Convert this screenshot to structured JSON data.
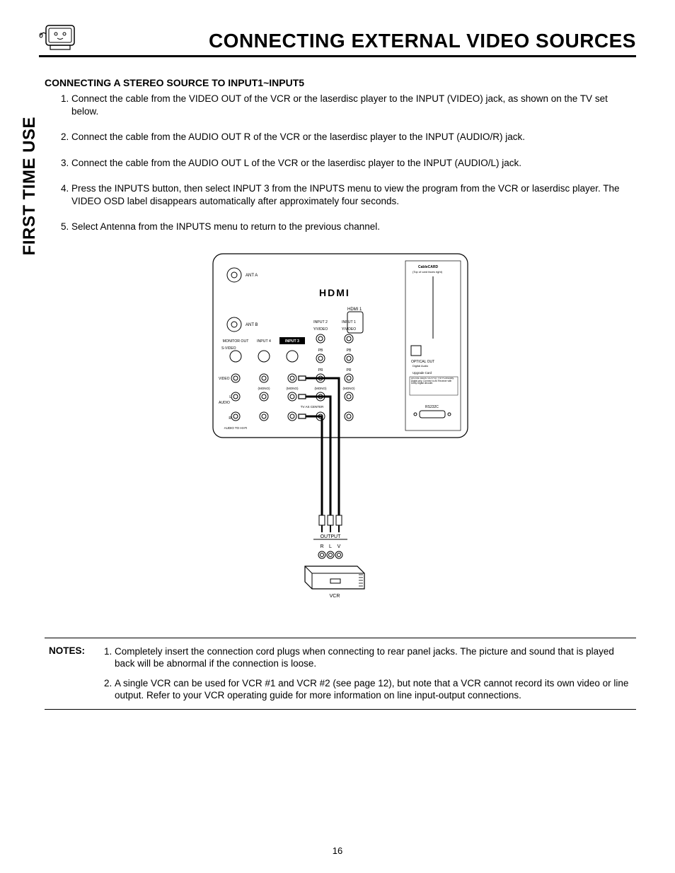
{
  "header": {
    "title": "CONNECTING EXTERNAL VIDEO SOURCES"
  },
  "sidebar": {
    "tab": "FIRST TIME USE"
  },
  "section_heading": "CONNECTING A STEREO SOURCE TO INPUT1~INPUT5",
  "steps": [
    "Connect the cable from the VIDEO OUT of the VCR or the laserdisc player to the INPUT (VIDEO) jack, as shown on the TV set below.",
    "Connect the cable from the AUDIO OUT R of the VCR or the laserdisc player to the INPUT (AUDIO/R) jack.",
    "Connect the cable from the AUDIO OUT L of the VCR or the laserdisc player to the INPUT (AUDIO/L) jack.",
    "Press the INPUTS button, then select INPUT 3 from the INPUTS menu to view the program from the VCR or laserdisc player. The VIDEO OSD label disappears automatically after approximately four seconds.",
    "Select Antenna from the INPUTS menu to return to the previous channel."
  ],
  "notes": {
    "label": "NOTES:",
    "items": [
      "Completely insert the connection cord plugs when connecting to rear panel jacks.  The picture and sound that is played back will be abnormal if the connection is loose.",
      "A single VCR can be used for VCR #1 and VCR #2 (see page 12), but note that a VCR cannot record its own video or line output.  Refer to your VCR operating guide for more information on line input-output connections."
    ]
  },
  "page_number": "16",
  "chart_data": {
    "type": "diagram",
    "description": "TV rear panel connection diagram showing cable routing from VCR OUTPUT (R, L, V) to TV INPUT 3 jacks",
    "tv_panel": {
      "coax": [
        "ANT A",
        "ANT B"
      ],
      "hdmi_block_label": "HDMI",
      "hdmi_port": "HDMI 1",
      "column_headers": [
        "MONITOR OUT",
        "INPUT 4",
        "INPUT 3",
        "INPUT 2",
        "INPUT 1"
      ],
      "highlighted_column": "INPUT 3",
      "video_row_label": "S-VIDEO",
      "component_labels_input2": [
        "Y/VIDEO",
        "PB",
        "PR"
      ],
      "component_labels_input1": [
        "Y/VIDEO",
        "PB",
        "PR"
      ],
      "row_labels": [
        "VIDEO",
        "AUDIO",
        "L (MONO)",
        "R"
      ],
      "mono_labels": [
        "(MONO)",
        "(MONO)",
        "(MONO)",
        "(MONO)"
      ],
      "center_label": "TV AS CENTER",
      "audio_to_hifi": "AUDIO TO HI-FI",
      "right_side": {
        "cablecard": "CableCARD",
        "cablecard_sub": "(Top of card faces right)",
        "optical": "OPTICAL OUT",
        "optical_sub": "Digital Audio",
        "upgrade": "Upgrade Card",
        "service_text": "DIGITAL AUDIO OUTPUT: For PCM/Dolby Digital only. Connect to AV Receiver with Dolby Digital decoder.",
        "rs232c": "RS232C"
      }
    },
    "vcr": {
      "output_label": "OUTPUT",
      "jacks": [
        "R",
        "L",
        "V"
      ],
      "device_label": "VCR"
    },
    "cable_routes": [
      {
        "from": "VCR.V",
        "to": "TV.INPUT3.VIDEO"
      },
      {
        "from": "VCR.L",
        "to": "TV.INPUT3.AUDIO_L"
      },
      {
        "from": "VCR.R",
        "to": "TV.INPUT3.AUDIO_R"
      }
    ]
  }
}
